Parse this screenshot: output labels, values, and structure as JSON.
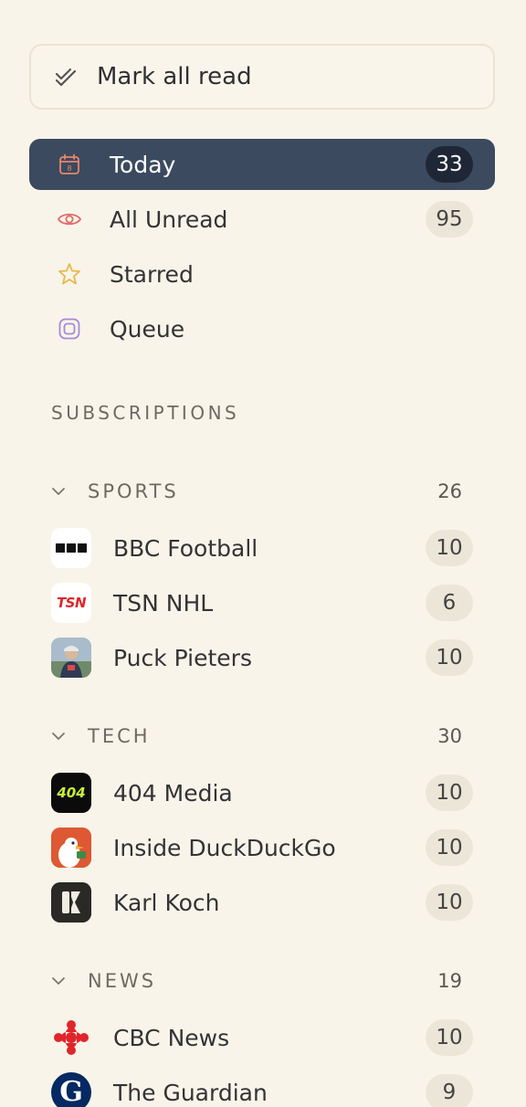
{
  "toolbar": {
    "mark_all_label": "Mark all read"
  },
  "nav": [
    {
      "label": "Today",
      "count": "33",
      "icon": "calendar-icon",
      "calendar_day": "8"
    },
    {
      "label": "All Unread",
      "count": "95",
      "icon": "eye-icon"
    },
    {
      "label": "Starred",
      "count": "",
      "icon": "star-icon"
    },
    {
      "label": "Queue",
      "count": "",
      "icon": "queue-icon"
    }
  ],
  "subscriptions_heading": "SUBSCRIPTIONS",
  "folders": [
    {
      "name": "SPORTS",
      "count": "26",
      "feeds": [
        {
          "name": "BBC Football",
          "count": "10",
          "icon": "bbc-logo"
        },
        {
          "name": "TSN NHL",
          "count": "6",
          "icon": "tsn-logo",
          "logo_text": "TSN"
        },
        {
          "name": "Puck Pieters",
          "count": "10",
          "icon": "puck-pieters-avatar"
        }
      ]
    },
    {
      "name": "TECH",
      "count": "30",
      "feeds": [
        {
          "name": "404 Media",
          "count": "10",
          "icon": "404-media-logo",
          "logo_text": "404"
        },
        {
          "name": "Inside DuckDuckGo",
          "count": "10",
          "icon": "duckduckgo-logo"
        },
        {
          "name": "Karl Koch",
          "count": "10",
          "icon": "karl-koch-logo"
        }
      ]
    },
    {
      "name": "NEWS",
      "count": "19",
      "feeds": [
        {
          "name": "CBC News",
          "count": "10",
          "icon": "cbc-logo"
        },
        {
          "name": "The Guardian",
          "count": "9",
          "icon": "guardian-logo",
          "logo_text": "G"
        }
      ]
    }
  ],
  "colors": {
    "background": "#f9f4e9",
    "active_bg": "#3b4a5f",
    "badge_bg": "#ece6d8",
    "calendar_icon": "#e8866a",
    "eye_icon": "#e06a6a",
    "star_icon": "#e8b84a",
    "queue_icon": "#a48ad8"
  }
}
